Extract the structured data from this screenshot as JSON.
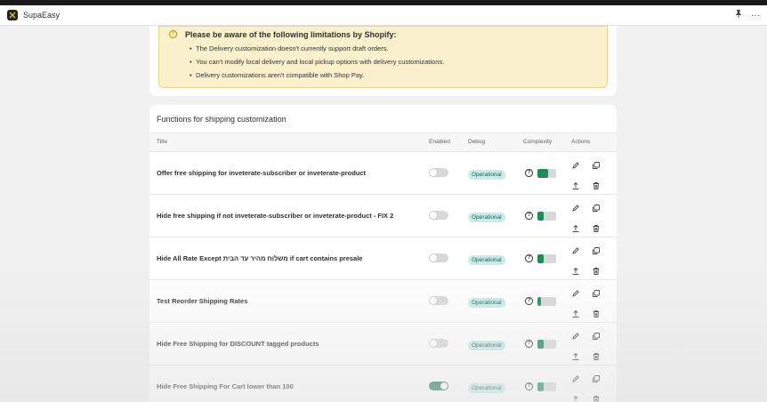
{
  "app": {
    "name": "SupaEasy",
    "pin_icon": "pin-icon",
    "more_label": "···"
  },
  "notice": {
    "icon": "warning-circle-icon",
    "title": "Please be aware of the following limitations by Shopify:",
    "items": [
      "The Delivery customization doesn't currently support draft orders.",
      "You can't modify local delivery and local pickup options with delivery customizations.",
      "Delivery customizations aren't compatible with Shop Pay."
    ]
  },
  "functions": {
    "title": "Functions for shipping customization",
    "headers": {
      "title": "Title",
      "enabled": "Enabled",
      "debug": "Debug",
      "complexity": "Complexity",
      "actions": "Actions"
    },
    "rows": [
      {
        "title": "Offer free shipping for inveterate-subscriber or inveterate-product",
        "enabled": false,
        "debug": "Operational",
        "complexity": 0.55
      },
      {
        "title": "Hide free shipping if not inveterate-subscriber or inveterate-product - FIX 2",
        "enabled": false,
        "debug": "Operational",
        "complexity": 0.35
      },
      {
        "title": "Hide All Rate Except משלוח מהיר עד הבית if cart contains presale",
        "enabled": false,
        "debug": "Operational",
        "complexity": 0.35
      },
      {
        "title": "Test Reorder Shipping Rates",
        "enabled": false,
        "debug": "Operational",
        "complexity": 0.2
      },
      {
        "title": "Hide Free Shipping for DISCOUNT tagged products",
        "enabled": false,
        "debug": "Operational",
        "complexity": 0.35
      },
      {
        "title": "Hide Free Shipping For Cart lower than 100",
        "enabled": true,
        "debug": "Operational",
        "complexity": 0.35
      }
    ]
  },
  "colors": {
    "accent": "#2a7a56",
    "badge_bg": "#c7ecea",
    "banner_bg": "#fcf1cd"
  }
}
